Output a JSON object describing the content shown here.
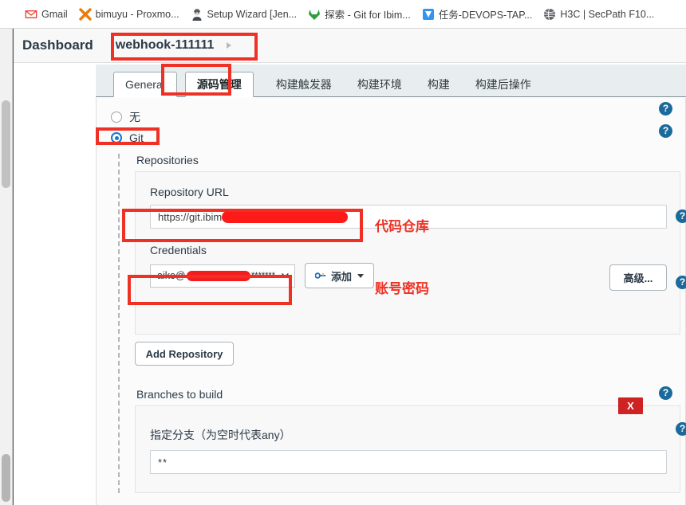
{
  "bookmarks": [
    {
      "label": "Gmail",
      "icon": "gmail-icon"
    },
    {
      "label": "bimuyu - Proxmo...",
      "icon": "proxmox-x-icon"
    },
    {
      "label": "Setup Wizard [Jen...",
      "icon": "jenkins-butler-icon"
    },
    {
      "label": "探索 - Git for Ibim...",
      "icon": "gitlab-tanuki-icon"
    },
    {
      "label": "任务-DEVOPS-TAP...",
      "icon": "tapd-icon"
    },
    {
      "label": "H3C | SecPath F10...",
      "icon": "globe-icon"
    }
  ],
  "header": {
    "dashboard_label": "Dashboard",
    "job_label": "webhook-111111"
  },
  "tabs": [
    {
      "label": "General",
      "style": "box"
    },
    {
      "label": "源码管理",
      "style": "box-active"
    },
    {
      "label": "构建触发器",
      "style": "plain"
    },
    {
      "label": "构建环境",
      "style": "plain"
    },
    {
      "label": "构建",
      "style": "plain"
    },
    {
      "label": "构建后操作",
      "style": "plain"
    }
  ],
  "scm": {
    "radio_none_label": "无",
    "radio_git_label": "Git",
    "repositories_label": "Repositories",
    "repository_url_label": "Repository URL",
    "repository_url_value_prefix": "https://git.ibim",
    "credentials_label": "Credentials",
    "credentials_value_prefix": "aike@",
    "credentials_value_suffix": "*******",
    "add_credentials_label": "添加",
    "advanced_label": "高级...",
    "add_repository_label": "Add Repository",
    "branches_label": "Branches to build",
    "branch_spec_label": "指定分支（为空时代表any）",
    "branch_spec_value": "**",
    "delete_branch_label": "X",
    "help_label": "?"
  },
  "annotations": {
    "repo_note": "代码仓库",
    "credentials_note": "账号密码"
  },
  "colors": {
    "annotation_red": "#ee3124",
    "help_blue": "#1b6a9c",
    "radio_blue": "#1675d1",
    "delete_red": "#cf2323",
    "redaction_red": "#f41c1c"
  }
}
